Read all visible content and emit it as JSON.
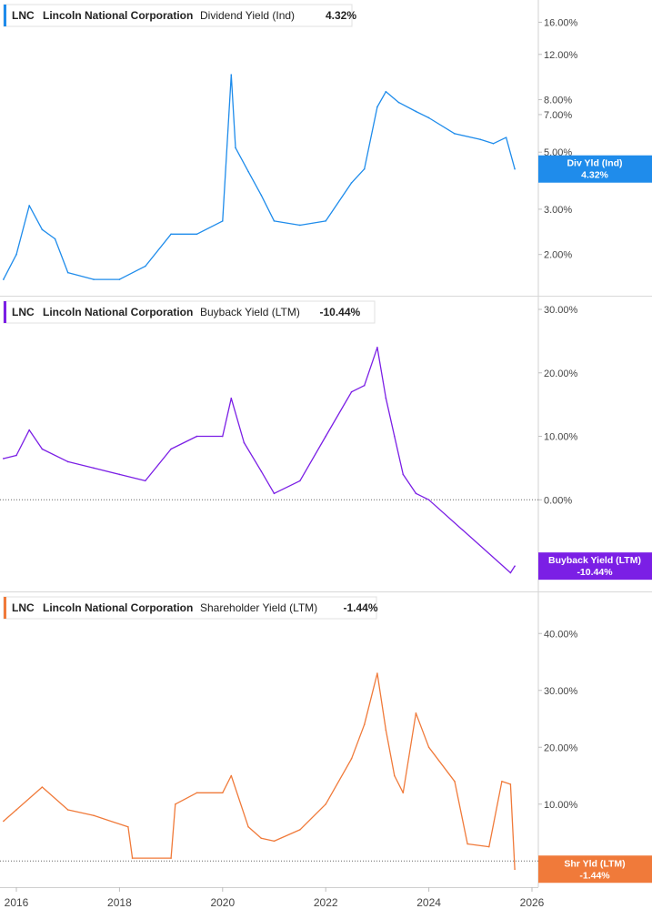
{
  "chart_data": [
    {
      "type": "line",
      "ticker": "LNC",
      "company": "Lincoln National Corporation",
      "metric": "Dividend Yield (Ind)",
      "latest": "4.32%",
      "badge": [
        "Div Yld (Ind)",
        "4.32%"
      ],
      "color": "#1f8ceb",
      "scale": "log",
      "ylim": [
        1.5,
        18
      ],
      "yticks": [
        2,
        3,
        5,
        7,
        8,
        12,
        16
      ],
      "ytick_labels": [
        "2.00%",
        "3.00%",
        "5.00%",
        "7.00%",
        "8.00%",
        "12.00%",
        "16.00%"
      ],
      "x": [
        "2015-10",
        "2016-01",
        "2016-04",
        "2016-07",
        "2016-10",
        "2017-01",
        "2017-07",
        "2018-01",
        "2018-07",
        "2019-01",
        "2019-07",
        "2020-01",
        "2020-03",
        "2020-04",
        "2020-07",
        "2020-10",
        "2021-01",
        "2021-07",
        "2022-01",
        "2022-07",
        "2022-10",
        "2023-01",
        "2023-03",
        "2023-06",
        "2023-10",
        "2024-01",
        "2024-07",
        "2025-01",
        "2025-04",
        "2025-07",
        "2025-09"
      ],
      "values": [
        1.6,
        2.0,
        3.1,
        2.5,
        2.3,
        1.7,
        1.6,
        1.6,
        1.8,
        2.4,
        2.4,
        2.7,
        10.0,
        5.2,
        4.2,
        3.4,
        2.7,
        2.6,
        2.7,
        3.8,
        4.3,
        7.5,
        8.6,
        7.8,
        7.2,
        6.8,
        5.9,
        5.6,
        5.4,
        5.7,
        4.3
      ]
    },
    {
      "type": "line",
      "ticker": "LNC",
      "company": "Lincoln National Corporation",
      "metric": "Buyback Yield (LTM)",
      "latest": "-10.44%",
      "badge": [
        "Buyback Yield (LTM)",
        "-10.44%"
      ],
      "color": "#7b1fe5",
      "scale": "linear",
      "ylim": [
        -13,
        30
      ],
      "yticks": [
        0,
        10,
        20,
        30
      ],
      "ytick_labels": [
        "0.00%",
        "10.00%",
        "20.00%",
        "30.00%"
      ],
      "zero_line": true,
      "x": [
        "2015-10",
        "2016-01",
        "2016-04",
        "2016-07",
        "2017-01",
        "2017-07",
        "2018-01",
        "2018-07",
        "2019-01",
        "2019-07",
        "2020-01",
        "2020-03",
        "2020-06",
        "2020-10",
        "2021-01",
        "2021-07",
        "2022-01",
        "2022-07",
        "2022-10",
        "2023-01",
        "2023-03",
        "2023-05",
        "2023-07",
        "2023-10",
        "2024-01",
        "2025-08",
        "2025-09"
      ],
      "values": [
        6.5,
        7.0,
        11.0,
        8.0,
        6.0,
        5.0,
        4.0,
        3.0,
        8.0,
        10.0,
        10.0,
        16.0,
        9.0,
        4.5,
        1.0,
        3.0,
        10.0,
        17.0,
        18.0,
        24.0,
        16.0,
        10.0,
        4.0,
        1.0,
        0.0,
        -11.5,
        -10.44
      ]
    },
    {
      "type": "line",
      "ticker": "LNC",
      "company": "Lincoln National Corporation",
      "metric": "Shareholder Yield (LTM)",
      "latest": "-1.44%",
      "badge": [
        "Shr Yld (LTM)",
        "-1.44%"
      ],
      "color": "#f07a3a",
      "scale": "linear",
      "ylim": [
        -3,
        45
      ],
      "yticks": [
        10,
        20,
        30,
        40
      ],
      "ytick_labels": [
        "10.00%",
        "20.00%",
        "30.00%",
        "40.00%"
      ],
      "zero_line": true,
      "x": [
        "2015-10",
        "2016-01",
        "2016-07",
        "2017-01",
        "2017-07",
        "2018-03",
        "2018-04",
        "2019-01",
        "2019-02",
        "2019-07",
        "2020-01",
        "2020-03",
        "2020-07",
        "2020-10",
        "2021-01",
        "2021-07",
        "2022-01",
        "2022-07",
        "2022-10",
        "2023-01",
        "2023-03",
        "2023-05",
        "2023-07",
        "2023-10",
        "2024-01",
        "2024-07",
        "2024-10",
        "2025-03",
        "2025-06",
        "2025-08",
        "2025-09"
      ],
      "values": [
        7.0,
        9.0,
        13.0,
        9.0,
        8.0,
        6.0,
        0.5,
        0.5,
        10.0,
        12.0,
        12.0,
        15.0,
        6.0,
        4.0,
        3.5,
        5.5,
        10.0,
        18.0,
        24.0,
        33.0,
        23.0,
        15.0,
        12.0,
        26.0,
        20.0,
        14.0,
        3.0,
        2.5,
        14.0,
        13.5,
        -1.44
      ]
    }
  ],
  "x_axis": {
    "ticks": [
      "2016",
      "2018",
      "2020",
      "2022",
      "2024",
      "2026"
    ]
  }
}
